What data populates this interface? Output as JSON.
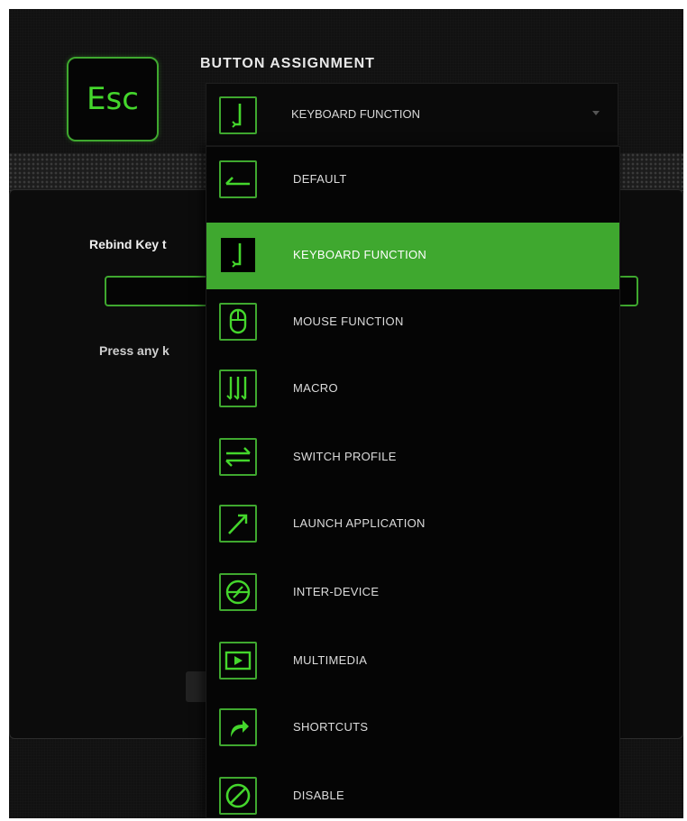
{
  "key": {
    "label": "Esc"
  },
  "section": {
    "title": "BUTTON ASSIGNMENT"
  },
  "assignment": {
    "selected_label": "KEYBOARD FUNCTION",
    "selected_icon": "keyboard-icon"
  },
  "rebind": {
    "label": "Rebind Key t",
    "hint": "Press any k"
  },
  "menu": {
    "items": [
      {
        "label": "DEFAULT",
        "icon": "default-arrow-icon"
      },
      {
        "label": "KEYBOARD FUNCTION",
        "icon": "keyboard-icon",
        "selected": true
      },
      {
        "label": "MOUSE FUNCTION",
        "icon": "mouse-icon"
      },
      {
        "label": "MACRO",
        "icon": "macro-icon"
      },
      {
        "label": "SWITCH PROFILE",
        "icon": "switch-profile-icon"
      },
      {
        "label": "LAUNCH APPLICATION",
        "icon": "launch-application-icon"
      },
      {
        "label": "INTER-DEVICE",
        "icon": "inter-device-icon"
      },
      {
        "label": "MULTIMEDIA",
        "icon": "multimedia-icon"
      },
      {
        "label": "SHORTCUTS",
        "icon": "shortcuts-icon"
      },
      {
        "label": "DISABLE",
        "icon": "disable-icon"
      }
    ]
  },
  "colors": {
    "accent": "#3fa82f",
    "accent_text": "#44d62c",
    "background": "#111111",
    "menu_background": "#050505"
  }
}
